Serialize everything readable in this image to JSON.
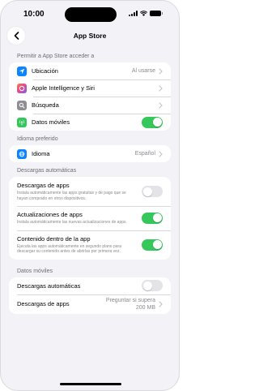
{
  "status_bar": {
    "time": "10:00"
  },
  "nav": {
    "title": "App Store"
  },
  "sections": {
    "access": {
      "header": "Permitir a App Store acceder a",
      "items": [
        {
          "label": "Ubicación",
          "value": "Al usarse",
          "icon": "location-arrow-icon",
          "icon_color": "#0a84ff"
        },
        {
          "label": "Apple Intelligence y Siri",
          "icon": "siri-icon",
          "icon_color": "#8e5cf7"
        },
        {
          "label": "Búsqueda",
          "icon": "search-icon",
          "icon_color": "#8e8e93"
        },
        {
          "label": "Datos móviles",
          "icon": "antenna-icon",
          "icon_color": "#34c759",
          "toggle": "on"
        }
      ]
    },
    "language": {
      "header": "Idioma preferido",
      "items": [
        {
          "label": "Idioma",
          "value": "Español",
          "icon": "globe-icon",
          "icon_color": "#0a84ff"
        }
      ]
    },
    "auto_downloads": {
      "header": "Descargas automáticas",
      "items": [
        {
          "label": "Descargas de apps",
          "description": "Instala automáticamente las apps gratuitas y de pago que se hayan comprado en otros dispositivos.",
          "toggle": "off"
        },
        {
          "label": "Actualizaciones de apps",
          "description": "Instala automáticamente las nuevas actualizaciones de apps.",
          "toggle": "on"
        },
        {
          "label": "Contenido dentro de la app",
          "description": "Ejecuta las apps automáticamente en segundo plano para descargar su contenido antes de abrirlas por primera vez.",
          "toggle": "on"
        }
      ]
    },
    "mobile_data": {
      "header": "Datos móviles",
      "items": [
        {
          "label": "Descargas automáticas",
          "toggle": "off"
        },
        {
          "label": "Descargas de apps",
          "value": "Preguntar si supera 200 MB"
        }
      ]
    }
  },
  "colors": {
    "toggle_on": "#34c759",
    "toggle_off": "#e3e3e8",
    "background": "#f2f2f7"
  }
}
